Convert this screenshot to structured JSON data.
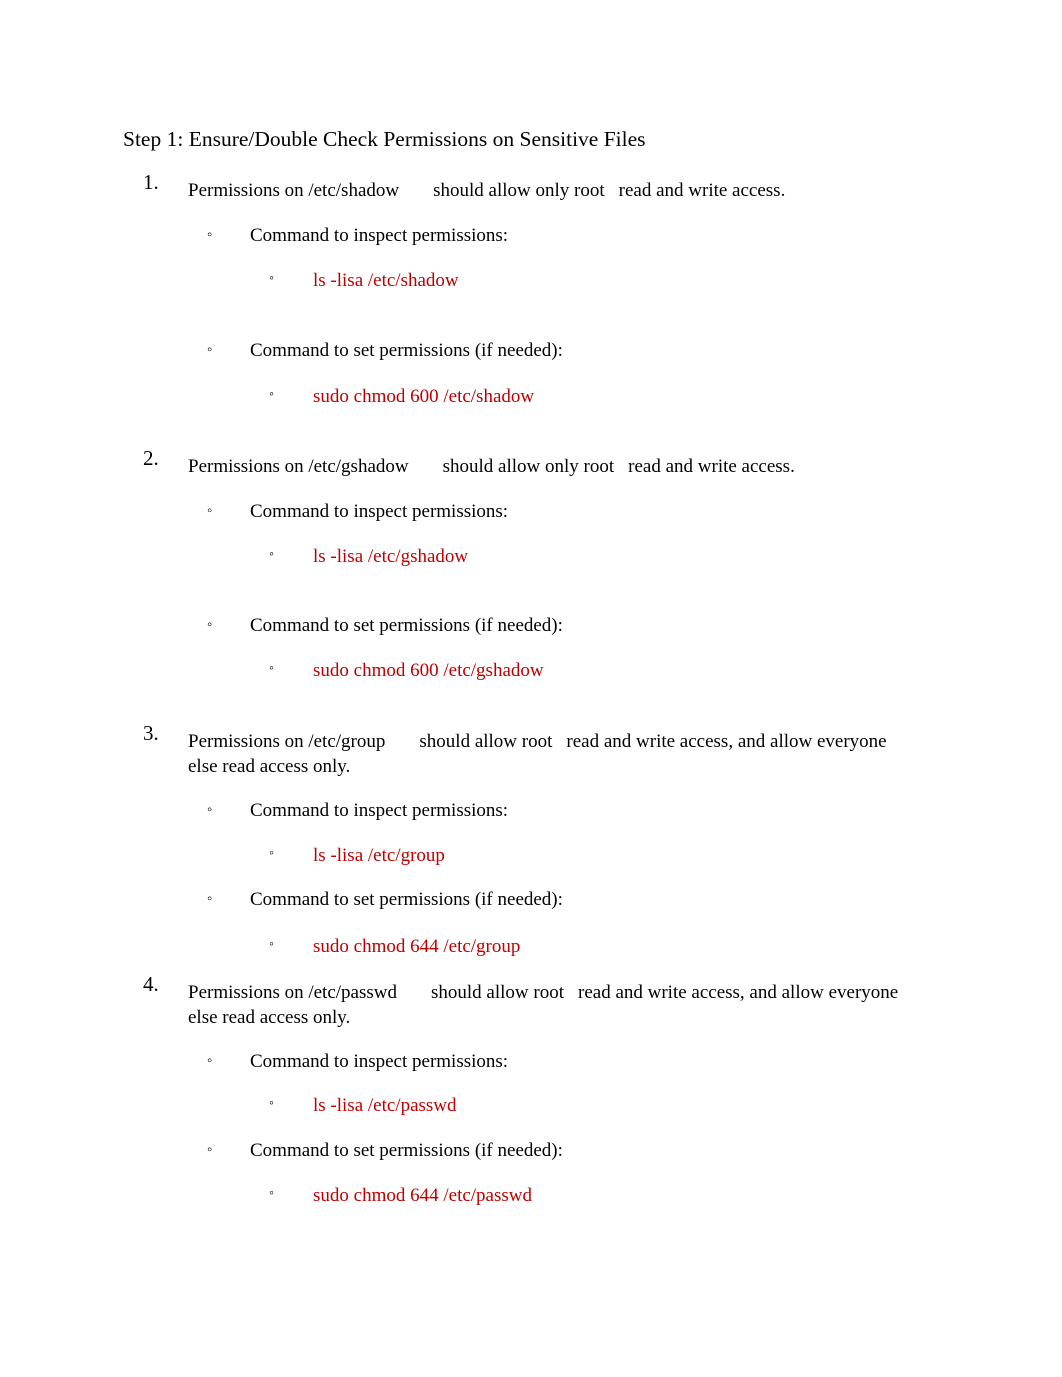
{
  "document": {
    "title": "Step 1: Ensure/Double Check Permissions on Sensitive Files",
    "colors": {
      "body_text": "#000000",
      "command_text": "#C00000",
      "page_background": "#FFFFFF"
    },
    "bullet_glyph": "◦",
    "labels": {
      "inspect": "Command to inspect permissions:",
      "set": "Command to set permissions (if needed):"
    },
    "items": [
      {
        "number": "1.",
        "text_part_1": "Permissions on /etc/shadow",
        "text_part_2": "should allow only root",
        "text_part_3": "read and write access.",
        "inspect_label": "Command to inspect permissions:",
        "inspect_command": "ls -lisa /etc/shadow",
        "set_label": "Command to set permissions (if needed):",
        "set_command": "sudo chmod 600 /etc/shadow"
      },
      {
        "number": "2.",
        "text_part_1": "Permissions on /etc/gshadow",
        "text_part_2": "should allow only root",
        "text_part_3": "read and write access.",
        "inspect_label": "Command to inspect permissions:",
        "inspect_command": "ls -lisa /etc/gshadow",
        "set_label": "Command to set permissions (if needed):",
        "set_command": "sudo chmod 600 /etc/gshadow"
      },
      {
        "number": "3.",
        "text_part_1": "Permissions on /etc/group",
        "text_part_2": "should allow root",
        "text_part_3": "read and write access, and allow everyone else read access only.",
        "inspect_label": "Command to inspect permissions:",
        "inspect_command": "ls -lisa /etc/group",
        "set_label": "Command to set permissions (if needed):",
        "set_command": "sudo chmod 644 /etc/group"
      },
      {
        "number": "4.",
        "text_part_1": "Permissions on /etc/passwd",
        "text_part_2": "should allow root",
        "text_part_3": "read and write access, and allow everyone else read access only.",
        "inspect_label": "Command to inspect permissions:",
        "inspect_command": "ls -lisa /etc/passwd",
        "set_label": "Command to set permissions (if needed):",
        "set_command": "sudo chmod 644 /etc/passwd"
      }
    ]
  }
}
